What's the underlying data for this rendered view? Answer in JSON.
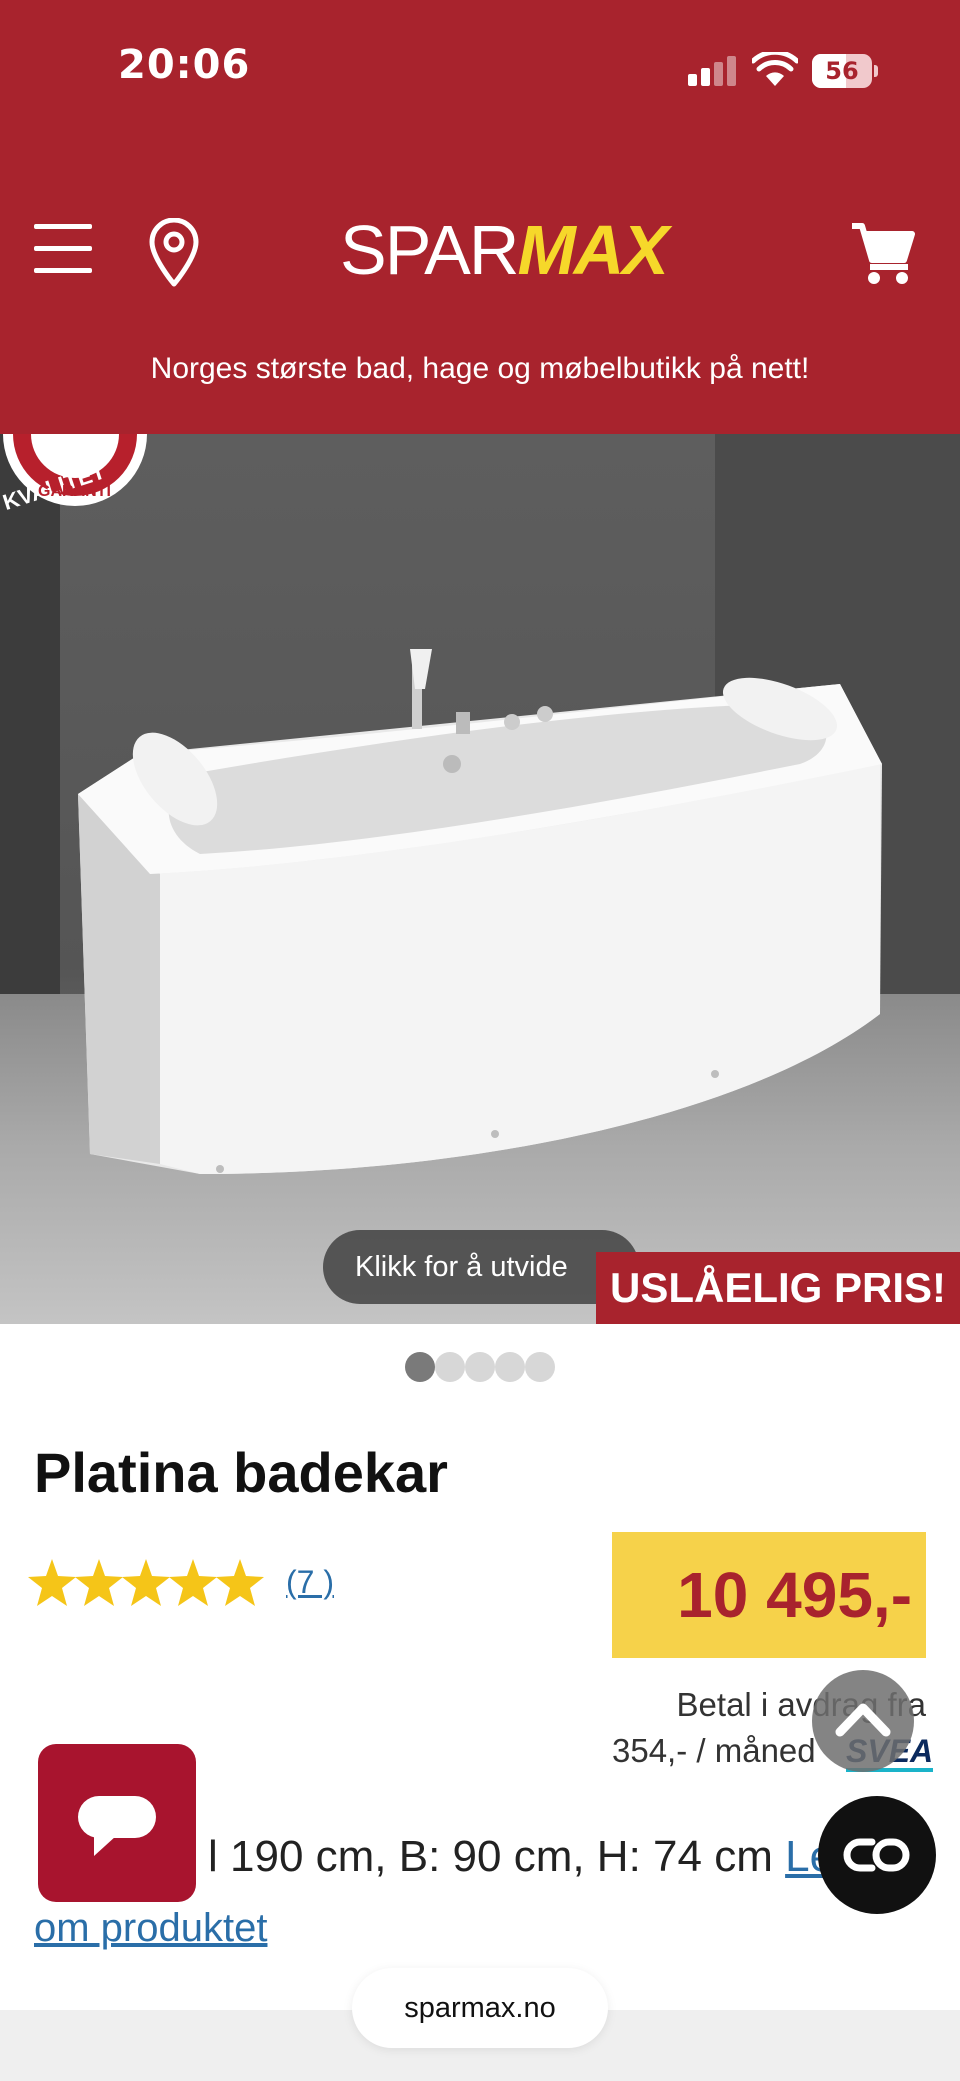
{
  "status_bar": {
    "time": "20:06",
    "battery": "56"
  },
  "header": {
    "logo_part1": "SPAR",
    "logo_part2": "MAX",
    "tagline": "Norges største bad, hage og møbelbutikk på nett!"
  },
  "gallery": {
    "badge_text_top": "KVALITET",
    "badge_text_bottom": "GARANTI",
    "expand_label": "Klikk for å utvide",
    "price_banner": "USLÅELIG PRIS!",
    "total_images": 5,
    "active_index": 0
  },
  "product": {
    "title": "Platina badekar",
    "rating": 5,
    "review_count_label": "(7 )",
    "price": "10 495,-",
    "installment_line1": "Betal i avdrag fra",
    "installment_line2": "354,- / måned",
    "installment_provider": "SVEA",
    "dimensions": "l 190 cm, B: 90 cm, H: 74 cm",
    "read_more_part1": "Les",
    "read_more_part2": "om produktet"
  },
  "footer": {
    "url": "sparmax.no"
  },
  "colors": {
    "brand_red": "#a8232d",
    "brand_yellow": "#f6d24a",
    "link_blue": "#2a6ea8"
  }
}
